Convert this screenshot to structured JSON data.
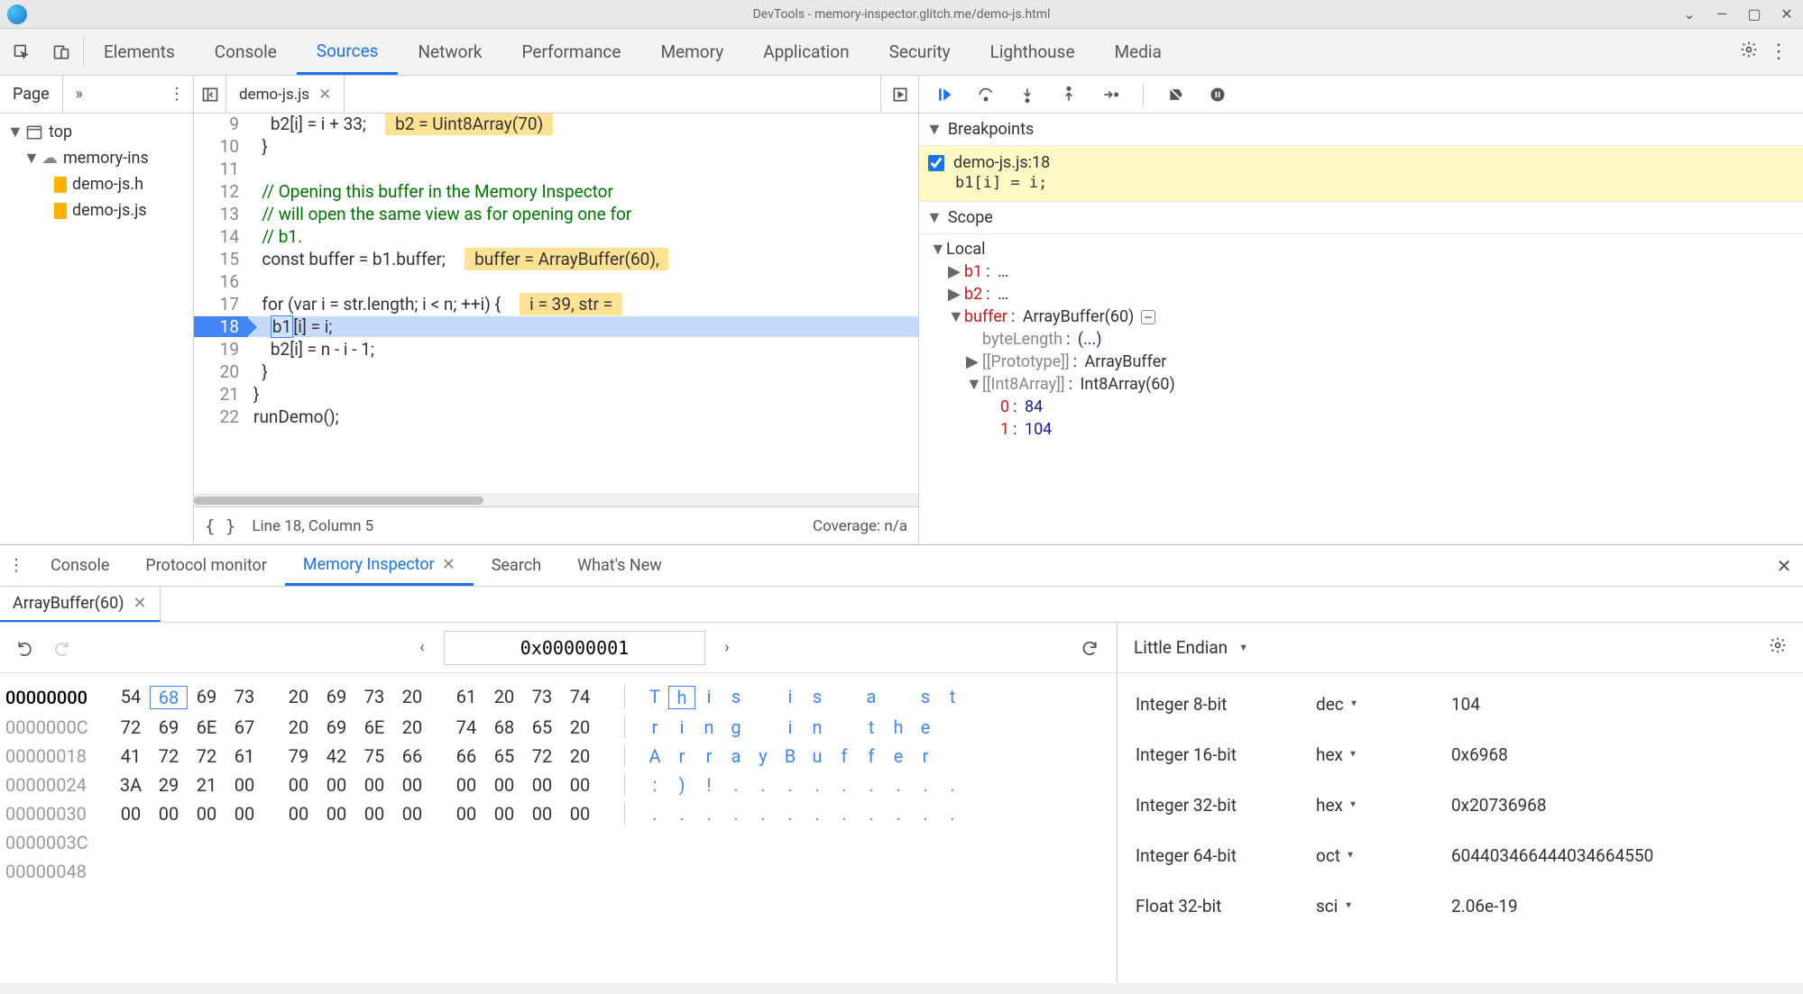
{
  "window": {
    "title": "DevTools - memory-inspector.glitch.me/demo-js.html"
  },
  "main_tabs": [
    "Elements",
    "Console",
    "Sources",
    "Network",
    "Performance",
    "Memory",
    "Application",
    "Security",
    "Lighthouse",
    "Media"
  ],
  "main_tabs_active_index": 2,
  "page_sidebar": {
    "tab_label": "Page",
    "tree": {
      "top": "top",
      "domain": "memory-ins",
      "files": [
        "demo-js.h",
        "demo-js.js"
      ]
    }
  },
  "source": {
    "open_file": "demo-js.js",
    "footer_pretty": "{ }",
    "footer_pos": "Line 18, Column 5",
    "footer_coverage": "Coverage: n/a",
    "lines": [
      {
        "n": 9,
        "code": "    b2[i] = i + 33;",
        "hint": "b2 = Uint8Array(70)"
      },
      {
        "n": 10,
        "code": "  }"
      },
      {
        "n": 11,
        "code": ""
      },
      {
        "n": 12,
        "code": "  // Opening this buffer in the Memory Inspector",
        "comment": true
      },
      {
        "n": 13,
        "code": "  // will open the same view as for opening one for",
        "comment": true
      },
      {
        "n": 14,
        "code": "  // b1.",
        "comment": true
      },
      {
        "n": 15,
        "code": "  const buffer = b1.buffer;",
        "hint": "buffer = ArrayBuffer(60),"
      },
      {
        "n": 16,
        "code": ""
      },
      {
        "n": 17,
        "code": "  for (var i = str.length; i < n; ++i) {",
        "hint": "i = 39, str ="
      },
      {
        "n": 18,
        "code": "    b1[i] = i;",
        "current": true,
        "selVar": "b1"
      },
      {
        "n": 19,
        "code": "    b2[i] = n - i - 1;"
      },
      {
        "n": 20,
        "code": "  }"
      },
      {
        "n": 21,
        "code": "}"
      },
      {
        "n": 22,
        "code": "runDemo();"
      }
    ]
  },
  "debugger": {
    "sections": {
      "breakpoints": {
        "title": "Breakpoints",
        "items": [
          {
            "checked": true,
            "label": "demo-js.js:18",
            "code": "b1[i] = i;"
          }
        ]
      },
      "scope": {
        "title": "Scope",
        "local_label": "Local",
        "vars": [
          {
            "key": "b1",
            "val": "…",
            "expandable": true
          },
          {
            "key": "b2",
            "val": "…",
            "expandable": true
          },
          {
            "key": "buffer",
            "val": "ArrayBuffer(60)",
            "expandable": true,
            "expanded": true,
            "mem": true,
            "children": [
              {
                "key": "byteLength",
                "val": "(...)",
                "grey": true
              },
              {
                "key": "[[Prototype]]",
                "val": "ArrayBuffer",
                "grey": true,
                "expandable": true
              },
              {
                "key": "[[Int8Array]]",
                "val": "Int8Array(60)",
                "grey": true,
                "expandable": true,
                "expanded": true,
                "children": [
                  {
                    "key": "0",
                    "val": "84"
                  },
                  {
                    "key": "1",
                    "val": "104"
                  }
                ]
              }
            ]
          }
        ]
      }
    }
  },
  "drawer": {
    "tabs": [
      "Console",
      "Protocol monitor",
      "Memory Inspector",
      "Search",
      "What's New"
    ],
    "active_index": 2
  },
  "memory_inspector": {
    "buffer_tab": "ArrayBuffer(60)",
    "address": "0x00000001",
    "endian": "Little Endian",
    "rows": [
      {
        "addr": "00000000",
        "active": true,
        "bytes": [
          "54",
          "68",
          "69",
          "73",
          "20",
          "69",
          "73",
          "20",
          "61",
          "20",
          "73",
          "74"
        ],
        "ascii": [
          "T",
          "h",
          "i",
          "s",
          " ",
          "i",
          "s",
          " ",
          "a",
          " ",
          "s",
          "t"
        ],
        "sel_byte_index": 1,
        "sel_ascii_index": 1
      },
      {
        "addr": "0000000C",
        "bytes": [
          "72",
          "69",
          "6E",
          "67",
          "20",
          "69",
          "6E",
          "20",
          "74",
          "68",
          "65",
          "20"
        ],
        "ascii": [
          "r",
          "i",
          "n",
          "g",
          " ",
          "i",
          "n",
          " ",
          "t",
          "h",
          "e",
          " "
        ]
      },
      {
        "addr": "00000018",
        "bytes": [
          "41",
          "72",
          "72",
          "61",
          "79",
          "42",
          "75",
          "66",
          "66",
          "65",
          "72",
          "20"
        ],
        "ascii": [
          "A",
          "r",
          "r",
          "a",
          "y",
          "B",
          "u",
          "f",
          "f",
          "e",
          "r",
          " "
        ]
      },
      {
        "addr": "00000024",
        "bytes": [
          "3A",
          "29",
          "21",
          "00",
          "00",
          "00",
          "00",
          "00",
          "00",
          "00",
          "00",
          "00"
        ],
        "ascii": [
          ":",
          ")",
          "!",
          ".",
          ".",
          ".",
          ".",
          ".",
          ".",
          ".",
          ".",
          "."
        ],
        "ascii_dim_from": 3
      },
      {
        "addr": "00000030",
        "bytes": [
          "00",
          "00",
          "00",
          "00",
          "00",
          "00",
          "00",
          "00",
          "00",
          "00",
          "00",
          "00"
        ],
        "ascii": [
          ".",
          ".",
          ".",
          ".",
          ".",
          ".",
          ".",
          ".",
          ".",
          ".",
          ".",
          "."
        ],
        "ascii_dim_from": 0
      },
      {
        "addr": "0000003C"
      },
      {
        "addr": "00000048"
      }
    ],
    "values": [
      {
        "label": "Integer 8-bit",
        "mode": "dec",
        "value": "104"
      },
      {
        "label": "Integer 16-bit",
        "mode": "hex",
        "value": "0x6968"
      },
      {
        "label": "Integer 32-bit",
        "mode": "hex",
        "value": "0x20736968"
      },
      {
        "label": "Integer 64-bit",
        "mode": "oct",
        "value": "604403466444034664550"
      },
      {
        "label": "Float 32-bit",
        "mode": "sci",
        "value": "2.06e-19"
      }
    ]
  }
}
